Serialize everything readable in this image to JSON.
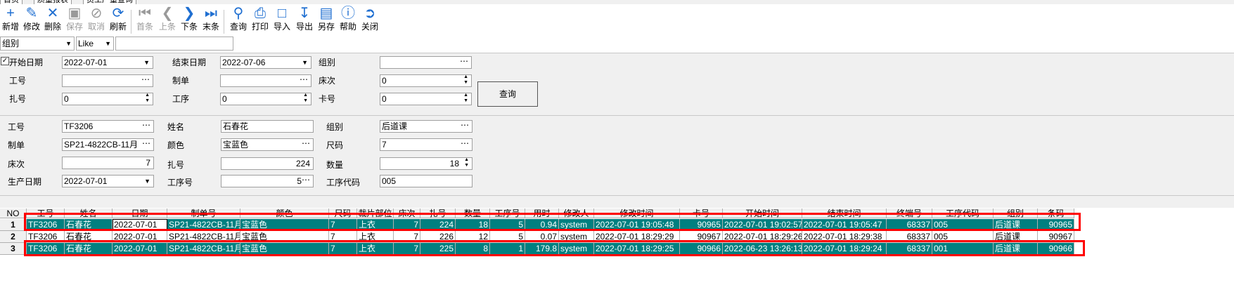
{
  "tabs": [
    "首页",
    "质量报表",
    "员工产量查询"
  ],
  "toolbar": {
    "items": [
      {
        "label": "新增",
        "icon": "add-icon",
        "enabled": true
      },
      {
        "label": "修改",
        "icon": "edit-icon",
        "enabled": true
      },
      {
        "label": "删除",
        "icon": "delete-icon",
        "enabled": true
      },
      {
        "label": "保存",
        "icon": "save-icon",
        "enabled": false
      },
      {
        "label": "取消",
        "icon": "cancel-icon",
        "enabled": false
      },
      {
        "label": "刷新",
        "icon": "refresh-icon",
        "enabled": true
      },
      {
        "label": "首条",
        "icon": "first-record-icon",
        "enabled": false
      },
      {
        "label": "上条",
        "icon": "prev-record-icon",
        "enabled": false
      },
      {
        "label": "下条",
        "icon": "next-record-icon",
        "enabled": true
      },
      {
        "label": "末条",
        "icon": "last-record-icon",
        "enabled": true
      },
      {
        "label": "查询",
        "icon": "search-icon",
        "enabled": true
      },
      {
        "label": "打印",
        "icon": "print-icon",
        "enabled": true
      },
      {
        "label": "导入",
        "icon": "import-icon",
        "enabled": true
      },
      {
        "label": "导出",
        "icon": "export-icon",
        "enabled": true
      },
      {
        "label": "另存",
        "icon": "save-as-icon",
        "enabled": true
      },
      {
        "label": "帮助",
        "icon": "help-icon",
        "enabled": true
      },
      {
        "label": "关闭",
        "icon": "close-icon",
        "enabled": true
      }
    ]
  },
  "filter": {
    "field": "组别",
    "operator": "Like",
    "value": ""
  },
  "query": {
    "start_date_checked": true,
    "start_date_label": "开始日期",
    "start_date": "2022-07-01",
    "end_date_label": "结束日期",
    "end_date": "2022-07-06",
    "group_label": "组别",
    "group": "",
    "worker_label": "工号",
    "worker": "",
    "order_label": "制单",
    "order": "",
    "bed_label": "床次",
    "bed": "0",
    "bundle_label": "扎号",
    "bundle": "0",
    "process_label": "工序",
    "process": "0",
    "card_label": "卡号",
    "card": "0",
    "query_button": "查询"
  },
  "detail": {
    "worker_label": "工号",
    "worker": "TF3206",
    "name_label": "姓名",
    "name": "石春花",
    "group_label": "组别",
    "group": "后道课",
    "order_label": "制单",
    "order": "SP21-4822CB-11月",
    "color_label": "颜色",
    "color": "宝蓝色",
    "size_label": "尺码",
    "size": "7",
    "bed_label": "床次",
    "bed": "7",
    "bundle_label": "扎号",
    "bundle": "224",
    "qty_label": "数量",
    "qty": "18",
    "date_label": "生产日期",
    "date": "2022-07-01",
    "process_no_label": "工序号",
    "process_no": "5",
    "process_code_label": "工序代码",
    "process_code": "005"
  },
  "grid": {
    "columns": [
      "NO",
      "工号",
      "姓名",
      "日期",
      "制单号",
      "颜色",
      "尺码",
      "裁片部位",
      "床次",
      "扎号",
      "数量",
      "工序号",
      "用时",
      "修改人",
      "修改时间",
      "卡号",
      "开始时间",
      "结束时间",
      "终端号",
      "工序代码",
      "组别",
      "条码"
    ],
    "rows": [
      {
        "no": "1",
        "cells": [
          "TF3206",
          "石春花",
          "2022-07-01",
          "SP21-4822CB-11月",
          "宝蓝色",
          "7",
          "上衣",
          "7",
          "224",
          "18",
          "5",
          "0.94",
          "system",
          "2022-07-01 19:05:48",
          "90965",
          "2022-07-01 19:02:57",
          "2022-07-01 19:05:47",
          "68337",
          "005",
          "后道课",
          "90965"
        ]
      },
      {
        "no": "2",
        "cells": [
          "TF3206",
          "石春花",
          "2022-07-01",
          "SP21-4822CB-11月",
          "宝蓝色",
          "7",
          "上衣",
          "7",
          "226",
          "12",
          "5",
          "0.07",
          "system",
          "2022-07-01 18:29:29",
          "90967",
          "2022-07-01 18:29:26",
          "2022-07-01 18:29:38",
          "68337",
          "005",
          "后道课",
          "90967"
        ]
      },
      {
        "no": "3",
        "cells": [
          "TF3206",
          "石春花",
          "2022-07-01",
          "SP21-4822CB-11月",
          "宝蓝色",
          "7",
          "上衣",
          "7",
          "225",
          "8",
          "1",
          "179.8",
          "system",
          "2022-07-01 18:29:25",
          "90966",
          "2022-06-23 13:26:13",
          "2022-07-01 18:29:24",
          "68337",
          "001",
          "后道课",
          "90966"
        ]
      }
    ]
  },
  "colors": {
    "selection": "#008080",
    "highlight_box": "#ff0000",
    "icon": "#1f6fd1"
  }
}
